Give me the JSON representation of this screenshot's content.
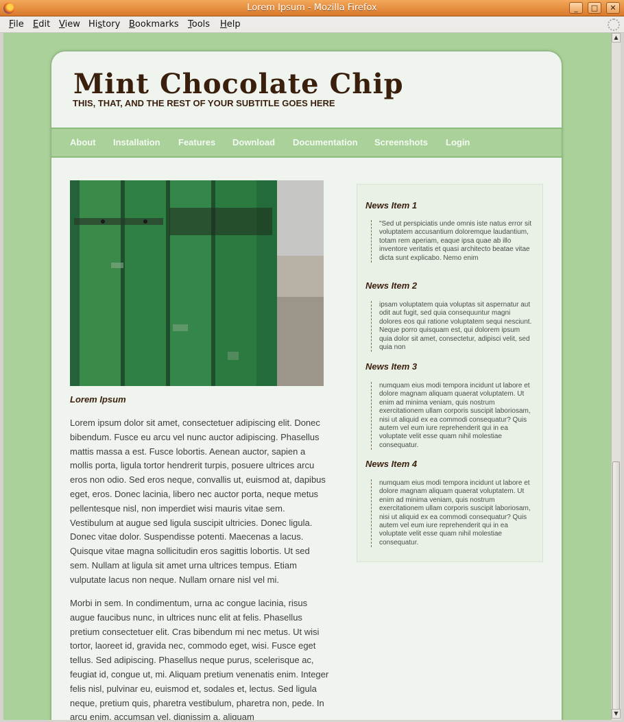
{
  "window": {
    "title": "Lorem Ipsum - Mozilla Firefox",
    "controls": {
      "minimize": "_",
      "maximize": "□",
      "close": "✕"
    }
  },
  "menu": {
    "items": [
      {
        "key": "F",
        "rest": "ile"
      },
      {
        "key": "E",
        "rest": "dit"
      },
      {
        "key": "V",
        "rest": "iew"
      },
      {
        "key": "",
        "pre": "Hi",
        "key2": "s",
        "rest": "tory"
      },
      {
        "key": "B",
        "rest": "ookmarks"
      },
      {
        "key": "T",
        "rest": "ools"
      },
      {
        "key": "H",
        "rest": "elp"
      }
    ],
    "labels": [
      "File",
      "Edit",
      "View",
      "History",
      "Bookmarks",
      "Tools",
      "Help"
    ]
  },
  "site": {
    "logo": "Mint Chocolate Chip",
    "subtitle": "THIS, THAT, AND THE REST OF YOUR SUBTITLE GOES HERE",
    "nav": [
      "About",
      "Installation",
      "Features",
      "Download",
      "Documentation",
      "Screenshots",
      "Login"
    ]
  },
  "main": {
    "image_caption": "Lorem Ipsum",
    "paragraphs": [
      "Lorem ipsum dolor sit amet, consectetuer adipiscing elit. Donec bibendum. Fusce eu arcu vel nunc auctor adipiscing. Phasellus mattis massa a est. Fusce lobortis. Aenean auctor, sapien a mollis porta, ligula tortor hendrerit turpis, posuere ultrices arcu eros non odio. Sed eros neque, convallis ut, euismod at, dapibus eget, eros. Donec lacinia, libero nec auctor porta, neque metus pellentesque nisl, non imperdiet wisi mauris vitae sem. Vestibulum at augue sed ligula suscipit ultricies. Donec ligula. Donec vitae dolor. Suspendisse potenti. Maecenas a lacus. Quisque vitae magna sollicitudin eros sagittis lobortis. Ut sed sem. Nullam at ligula sit amet urna ultrices tempus. Etiam vulputate lacus non neque. Nullam ornare nisl vel mi.",
      "Morbi in sem. In condimentum, urna ac congue lacinia, risus augue faucibus nunc, in ultrices nunc elit at felis. Phasellus pretium consectetuer elit. Cras bibendum mi nec metus. Ut wisi tortor, laoreet id, gravida nec, commodo eget, wisi. Fusce eget tellus. Sed adipiscing. Phasellus neque purus, scelerisque ac, feugiat id, congue ut, mi. Aliquam pretium venenatis enim. Integer felis nisl, pulvinar eu, euismod et, sodales et, lectus. Sed ligula neque, pretium quis, pharetra vestibulum, pharetra non, pede. In arcu enim, accumsan vel, dignissim a, aliquam"
    ]
  },
  "news": [
    {
      "title": "News Item 1",
      "body": "\"Sed ut perspiciatis unde omnis iste natus error sit voluptatem accusantium doloremque laudantium, totam rem aperiam, eaque ipsa quae ab illo inventore veritatis et quasi architecto beatae vitae dicta sunt explicabo. Nemo enim"
    },
    {
      "title": "News Item 2",
      "body": "ipsam voluptatem quia voluptas sit aspernatur aut odit aut fugit, sed quia consequuntur magni dolores eos qui ratione voluptatem sequi nesciunt. Neque porro quisquam est, qui dolorem ipsum quia dolor sit amet, consectetur, adipisci velit, sed quia non"
    },
    {
      "title": "News Item 3",
      "body": "numquam eius modi tempora incidunt ut labore et dolore magnam aliquam quaerat voluptatem. Ut enim ad minima veniam, quis nostrum exercitationem ullam corporis suscipit laboriosam, nisi ut aliquid ex ea commodi consequatur? Quis autem vel eum iure reprehenderit qui in ea voluptate velit esse quam nihil molestiae consequatur."
    },
    {
      "title": "News Item 4",
      "body": "numquam eius modi tempora incidunt ut labore et dolore magnam aliquam quaerat voluptatem. Ut enim ad minima veniam, quis nostrum exercitationem ullam corporis suscipit laboriosam, nisi ut aliquid ex ea commodi consequatur? Quis autem vel eum iure reprehenderit qui in ea voluptate velit esse quam nihil molestiae consequatur."
    }
  ],
  "colors": {
    "page_background": "#a9d199",
    "content_background": "#eff4ee",
    "accent_brown": "#3b1f0d",
    "nav_background": "#a9d199",
    "titlebar": "#e88c3c"
  },
  "icons": {
    "app": "firefox-icon",
    "loading": "throbber-icon",
    "scroll_up": "scroll-up-arrow-icon",
    "scroll_down": "scroll-down-arrow-icon"
  }
}
